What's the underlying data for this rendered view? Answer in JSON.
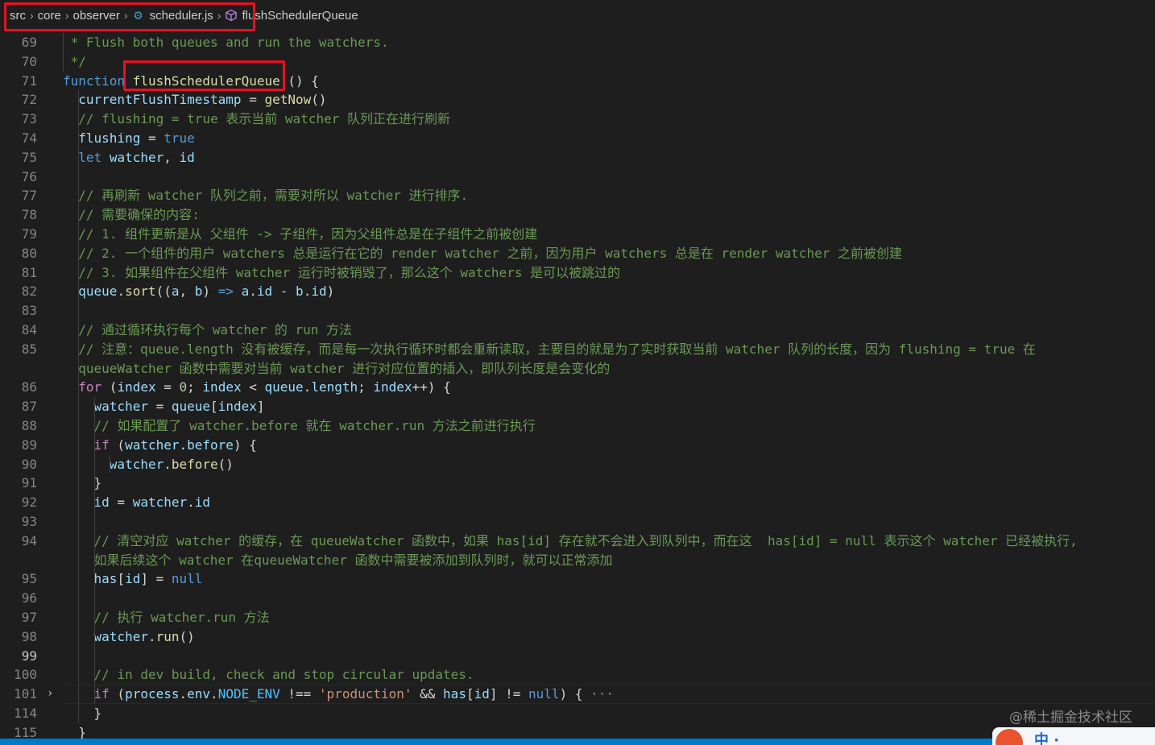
{
  "breadcrumb": {
    "items": [
      "src",
      "core",
      "observer",
      "scheduler.js",
      "flushSchedulerQueue"
    ]
  },
  "editor": {
    "lines": [
      {
        "n": "69",
        "tokens": [
          [
            " * Flush both queues and run the watchers.",
            "cm"
          ]
        ]
      },
      {
        "n": "70",
        "tokens": [
          [
            " */",
            "cm"
          ]
        ]
      },
      {
        "n": "71",
        "tokens": [
          [
            "function",
            "kw"
          ],
          [
            " ",
            "op"
          ],
          [
            "flushSchedulerQueue",
            "fn"
          ],
          [
            " () {",
            "op"
          ]
        ]
      },
      {
        "n": "72",
        "tokens": [
          [
            "  ",
            "op"
          ],
          [
            "currentFlushTimestamp",
            "var"
          ],
          [
            " = ",
            "op"
          ],
          [
            "getNow",
            "fn"
          ],
          [
            "()",
            "op"
          ]
        ]
      },
      {
        "n": "73",
        "tokens": [
          [
            "  // flushing = true 表示当前 watcher 队列正在进行刷新",
            "cm"
          ]
        ]
      },
      {
        "n": "74",
        "tokens": [
          [
            "  ",
            "op"
          ],
          [
            "flushing",
            "var"
          ],
          [
            " = ",
            "op"
          ],
          [
            "true",
            "kw"
          ]
        ]
      },
      {
        "n": "75",
        "tokens": [
          [
            "  ",
            "op"
          ],
          [
            "let",
            "kw"
          ],
          [
            " ",
            "op"
          ],
          [
            "watcher",
            "var"
          ],
          [
            ", ",
            "op"
          ],
          [
            "id",
            "var"
          ]
        ]
      },
      {
        "n": "76",
        "tokens": []
      },
      {
        "n": "77",
        "tokens": [
          [
            "  // 再刷新 watcher 队列之前，需要对所以 watcher 进行排序.",
            "cm"
          ]
        ]
      },
      {
        "n": "78",
        "tokens": [
          [
            "  // 需要确保的内容:",
            "cm"
          ]
        ]
      },
      {
        "n": "79",
        "tokens": [
          [
            "  // 1. 组件更新是从 父组件 -> 子组件，因为父组件总是在子组件之前被创建",
            "cm"
          ]
        ]
      },
      {
        "n": "80",
        "tokens": [
          [
            "  // 2. 一个组件的用户 watchers 总是运行在它的 render watcher 之前，因为用户 watchers 总是在 render watcher 之前被创建",
            "cm"
          ]
        ]
      },
      {
        "n": "81",
        "tokens": [
          [
            "  // 3. 如果组件在父组件 watcher 运行时被销毁了，那么这个 watchers 是可以被跳过的",
            "cm"
          ]
        ]
      },
      {
        "n": "82",
        "tokens": [
          [
            "  ",
            "op"
          ],
          [
            "queue",
            "var"
          ],
          [
            ".",
            "op"
          ],
          [
            "sort",
            "fn"
          ],
          [
            "((",
            "op"
          ],
          [
            "a",
            "var"
          ],
          [
            ", ",
            "op"
          ],
          [
            "b",
            "var"
          ],
          [
            ") ",
            "op"
          ],
          [
            "=>",
            "kw"
          ],
          [
            " ",
            "op"
          ],
          [
            "a",
            "var"
          ],
          [
            ".",
            "op"
          ],
          [
            "id",
            "var"
          ],
          [
            " - ",
            "op"
          ],
          [
            "b",
            "var"
          ],
          [
            ".",
            "op"
          ],
          [
            "id",
            "var"
          ],
          [
            ")",
            "op"
          ]
        ]
      },
      {
        "n": "83",
        "tokens": []
      },
      {
        "n": "84",
        "tokens": [
          [
            "  // 通过循环执行每个 watcher 的 run 方法",
            "cm"
          ]
        ]
      },
      {
        "n": "85",
        "tokens": [
          [
            "  // 注意：queue.length 没有被缓存，而是每一次执行循环时都会重新读取，主要目的就是为了实时获取当前 watcher 队列的长度，因为 flushing = true 在",
            "cm"
          ]
        ]
      },
      {
        "n": "",
        "tokens": [
          [
            "  queueWatcher 函数中需要对当前 watcher 进行对应位置的插入，即队列长度是会变化的",
            "cm"
          ]
        ]
      },
      {
        "n": "86",
        "tokens": [
          [
            "  ",
            "op"
          ],
          [
            "for",
            "ctl"
          ],
          [
            " (",
            "op"
          ],
          [
            "index",
            "var"
          ],
          [
            " = ",
            "op"
          ],
          [
            "0",
            "num"
          ],
          [
            "; ",
            "op"
          ],
          [
            "index",
            "var"
          ],
          [
            " < ",
            "op"
          ],
          [
            "queue",
            "var"
          ],
          [
            ".",
            "op"
          ],
          [
            "length",
            "var"
          ],
          [
            "; ",
            "op"
          ],
          [
            "index",
            "var"
          ],
          [
            "++) {",
            "op"
          ]
        ]
      },
      {
        "n": "87",
        "tokens": [
          [
            "    ",
            "op"
          ],
          [
            "watcher",
            "var"
          ],
          [
            " = ",
            "op"
          ],
          [
            "queue",
            "var"
          ],
          [
            "[",
            "op"
          ],
          [
            "index",
            "var"
          ],
          [
            "]",
            "op"
          ]
        ]
      },
      {
        "n": "88",
        "tokens": [
          [
            "    // 如果配置了 watcher.before 就在 watcher.run 方法之前进行执行",
            "cm"
          ]
        ]
      },
      {
        "n": "89",
        "tokens": [
          [
            "    ",
            "op"
          ],
          [
            "if",
            "ctl"
          ],
          [
            " (",
            "op"
          ],
          [
            "watcher",
            "var"
          ],
          [
            ".",
            "op"
          ],
          [
            "before",
            "var"
          ],
          [
            ") {",
            "op"
          ]
        ]
      },
      {
        "n": "90",
        "tokens": [
          [
            "      ",
            "op"
          ],
          [
            "watcher",
            "var"
          ],
          [
            ".",
            "op"
          ],
          [
            "before",
            "fn"
          ],
          [
            "()",
            "op"
          ]
        ]
      },
      {
        "n": "91",
        "tokens": [
          [
            "    }",
            "op"
          ]
        ]
      },
      {
        "n": "92",
        "tokens": [
          [
            "    ",
            "op"
          ],
          [
            "id",
            "var"
          ],
          [
            " = ",
            "op"
          ],
          [
            "watcher",
            "var"
          ],
          [
            ".",
            "op"
          ],
          [
            "id",
            "var"
          ]
        ]
      },
      {
        "n": "93",
        "tokens": []
      },
      {
        "n": "94",
        "tokens": [
          [
            "    // 清空对应 watcher 的缓存，在 queueWatcher 函数中，如果 has[id] 存在就不会进入到队列中，而在这  has[id] = null 表示这个 watcher 已经被执行,",
            "cm"
          ]
        ]
      },
      {
        "n": "",
        "tokens": [
          [
            "    如果后续这个 watcher 在queueWatcher 函数中需要被添加到队列时，就可以正常添加",
            "cm"
          ]
        ]
      },
      {
        "n": "95",
        "tokens": [
          [
            "    ",
            "op"
          ],
          [
            "has",
            "var"
          ],
          [
            "[",
            "op"
          ],
          [
            "id",
            "var"
          ],
          [
            "] = ",
            "op"
          ],
          [
            "null",
            "kw"
          ]
        ]
      },
      {
        "n": "96",
        "tokens": []
      },
      {
        "n": "97",
        "tokens": [
          [
            "    // 执行 watcher.run 方法",
            "cm"
          ]
        ]
      },
      {
        "n": "98",
        "tokens": [
          [
            "    ",
            "op"
          ],
          [
            "watcher",
            "var"
          ],
          [
            ".",
            "op"
          ],
          [
            "run",
            "fn"
          ],
          [
            "()",
            "op"
          ]
        ]
      },
      {
        "n": "99",
        "tokens": []
      },
      {
        "n": "100",
        "tokens": [
          [
            "    // in dev build, check and stop circular updates.",
            "cm"
          ]
        ]
      },
      {
        "n": "101",
        "tokens": [
          [
            "    ",
            "op"
          ],
          [
            "if",
            "ctl"
          ],
          [
            " (",
            "op"
          ],
          [
            "process",
            "var"
          ],
          [
            ".",
            "op"
          ],
          [
            "env",
            "var"
          ],
          [
            ".",
            "op"
          ],
          [
            "NODE_ENV",
            "const"
          ],
          [
            " !== ",
            "op"
          ],
          [
            "'production'",
            "str"
          ],
          [
            " && ",
            "op"
          ],
          [
            "has",
            "var"
          ],
          [
            "[",
            "op"
          ],
          [
            "id",
            "var"
          ],
          [
            "] != ",
            "op"
          ],
          [
            "null",
            "kw"
          ],
          [
            ") { ",
            "op"
          ],
          [
            "···",
            "ell"
          ]
        ]
      },
      {
        "n": "114",
        "tokens": [
          [
            "    }",
            "op"
          ]
        ]
      },
      {
        "n": "115",
        "tokens": [
          [
            "  }",
            "op"
          ]
        ]
      }
    ]
  },
  "watermark": "@稀土掘金技术社区",
  "tray": {
    "text": "中 ·"
  }
}
